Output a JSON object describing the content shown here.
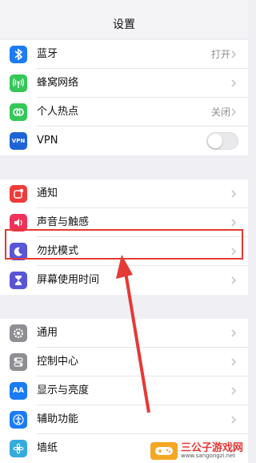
{
  "header": {
    "title": "设置"
  },
  "groups": [
    {
      "rows": [
        {
          "label": "蓝牙",
          "value": "打开",
          "icon": "bluetooth-icon",
          "color": "#1b7cf5"
        },
        {
          "label": "蜂窝网络",
          "value": "",
          "icon": "cellular-icon",
          "color": "#34c759"
        },
        {
          "label": "个人热点",
          "value": "关闭",
          "icon": "hotspot-icon",
          "color": "#34c759"
        },
        {
          "label": "VPN",
          "value": "",
          "icon": "vpn-icon",
          "color": "#1e63d6",
          "icon_text": "VPN",
          "toggle": false
        }
      ]
    },
    {
      "rows": [
        {
          "label": "通知",
          "value": "",
          "icon": "notifications-icon",
          "color": "#ef3b3b"
        },
        {
          "label": "声音与触感",
          "value": "",
          "icon": "sound-icon",
          "color": "#f0335a"
        },
        {
          "label": "勿扰模式",
          "value": "",
          "icon": "moon-icon",
          "color": "#5856d6",
          "highlighted": true
        },
        {
          "label": "屏幕使用时间",
          "value": "",
          "icon": "hourglass-icon",
          "color": "#5856d6"
        }
      ]
    },
    {
      "rows": [
        {
          "label": "通用",
          "value": "",
          "icon": "gear-icon",
          "color": "#8e8e93"
        },
        {
          "label": "控制中心",
          "value": "",
          "icon": "control-center-icon",
          "color": "#8e8e93"
        },
        {
          "label": "显示与亮度",
          "value": "",
          "icon": "display-icon",
          "color": "#1b7cf5",
          "icon_text": "AA"
        },
        {
          "label": "辅助功能",
          "value": "",
          "icon": "accessibility-icon",
          "color": "#1b7cf5"
        },
        {
          "label": "墙纸",
          "value": "",
          "icon": "wallpaper-icon",
          "color": "#35aadc"
        }
      ]
    }
  ],
  "watermark": {
    "title": "三公子游戏网",
    "url": "www.sangongzi.net"
  },
  "colors": {
    "highlight": "#e53935",
    "background": "#efeff4"
  }
}
